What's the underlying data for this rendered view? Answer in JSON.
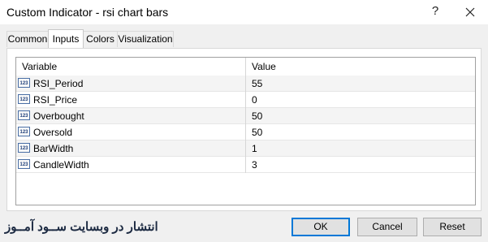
{
  "window": {
    "title": "Custom Indicator - rsi chart bars",
    "help_label": "?"
  },
  "tabs": [
    {
      "label": "Common",
      "active": false
    },
    {
      "label": "Inputs",
      "active": true
    },
    {
      "label": "Colors",
      "active": false
    },
    {
      "label": "Visualization",
      "active": false
    }
  ],
  "table": {
    "columns": [
      "Variable",
      "Value"
    ],
    "row_icon_text": "123",
    "rows": [
      {
        "variable": "RSI_Period",
        "value": "55"
      },
      {
        "variable": "RSI_Price",
        "value": "0"
      },
      {
        "variable": "Overbought",
        "value": "50"
      },
      {
        "variable": "Oversold",
        "value": "50"
      },
      {
        "variable": "BarWidth",
        "value": "1"
      },
      {
        "variable": "CandleWidth",
        "value": "3"
      }
    ]
  },
  "watermark": "انتشار در وبسایت ســود آمــوز",
  "buttons": {
    "ok": "OK",
    "cancel": "Cancel",
    "reset": "Reset"
  },
  "colors": {
    "accent": "#0078d7"
  },
  "icons": {
    "close": "close-icon",
    "row": "integer-icon"
  }
}
